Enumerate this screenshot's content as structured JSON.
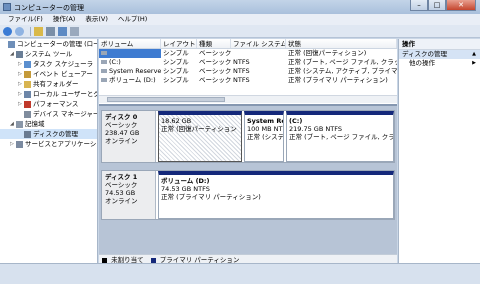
{
  "window": {
    "title": "コンピューターの管理",
    "min": "–",
    "max": "□",
    "close": "✕"
  },
  "menu": [
    "ファイル(F)",
    "操作(A)",
    "表示(V)",
    "ヘルプ(H)"
  ],
  "tree": [
    {
      "label": "コンピューターの管理 (ローカ",
      "indent": 0,
      "tw": "",
      "color": "#6f8fb8"
    },
    {
      "label": "システム ツール",
      "indent": 1,
      "tw": "◢",
      "color": "#6a7e96"
    },
    {
      "label": "タスク スケジューラ",
      "indent": 2,
      "tw": "▷",
      "color": "#5b8fcf"
    },
    {
      "label": "イベント ビューアー",
      "indent": 2,
      "tw": "▷",
      "color": "#c49a3a"
    },
    {
      "label": "共有フォルダー",
      "indent": 2,
      "tw": "▷",
      "color": "#d8b450"
    },
    {
      "label": "ローカル ユーザーとグ",
      "indent": 2,
      "tw": "▷",
      "color": "#6d86a8"
    },
    {
      "label": "パフォーマンス",
      "indent": 2,
      "tw": "▷",
      "color": "#c0392b"
    },
    {
      "label": "デバイス マネージャー",
      "indent": 2,
      "tw": "",
      "color": "#7f8c9d"
    },
    {
      "label": "記憶域",
      "indent": 1,
      "tw": "◢",
      "color": "#8a97a8"
    },
    {
      "label": "ディスクの管理",
      "indent": 2,
      "tw": "",
      "color": "#6a7b91",
      "selected": true
    },
    {
      "label": "サービスとアプリケーション",
      "indent": 1,
      "tw": "▷",
      "color": "#7b8aa0"
    }
  ],
  "volume_headers": [
    "ボリューム",
    "レイアウト",
    "種類",
    "ファイル システム",
    "状態"
  ],
  "volumes": [
    {
      "name": "",
      "layout": "シンプル",
      "type": "ベーシック",
      "fs": "",
      "status": "正常 (回復パーティション)",
      "selected": true
    },
    {
      "name": "(C:)",
      "layout": "シンプル",
      "type": "ベーシック",
      "fs": "NTFS",
      "status": "正常 (ブート, ページ ファイル, クラッ"
    },
    {
      "name": "System Reserved",
      "layout": "シンプル",
      "type": "ベーシック",
      "fs": "NTFS",
      "status": "正常 (システム, アクティブ, プライマリ"
    },
    {
      "name": "ボリューム (D:)",
      "layout": "シンプル",
      "type": "ベーシック",
      "fs": "NTFS",
      "status": "正常 (プライマリ パーティション)"
    }
  ],
  "disks": [
    {
      "name": "ディスク 0",
      "kind": "ベーシック",
      "size": "238.47 GB",
      "state": "オンライン",
      "partitions": [
        {
          "name": "",
          "line2": "18.62 GB",
          "line3": "正常 (回復パーティション",
          "hatched": true
        },
        {
          "name": "System Re",
          "line2": "100 MB NTI",
          "line3": "正常 (システ"
        },
        {
          "name": "(C:)",
          "line2": "219.75 GB NTFS",
          "line3": "正常 (ブート, ページ ファイル, クラッ"
        }
      ]
    },
    {
      "name": "ディスク 1",
      "kind": "ベーシック",
      "size": "74.53 GB",
      "state": "オンライン",
      "partitions": [
        {
          "name": "ボリューム (D:)",
          "line2": "74.53 GB NTFS",
          "line3": "正常 (プライマリ パーティション)"
        }
      ]
    }
  ],
  "legend": [
    {
      "label": "未割り当て",
      "color": "#000000"
    },
    {
      "label": "プライマリ パーティション",
      "color": "#14287a"
    }
  ],
  "actions": {
    "header": "操作",
    "section": "ディスクの管理",
    "item": "他の操作"
  }
}
